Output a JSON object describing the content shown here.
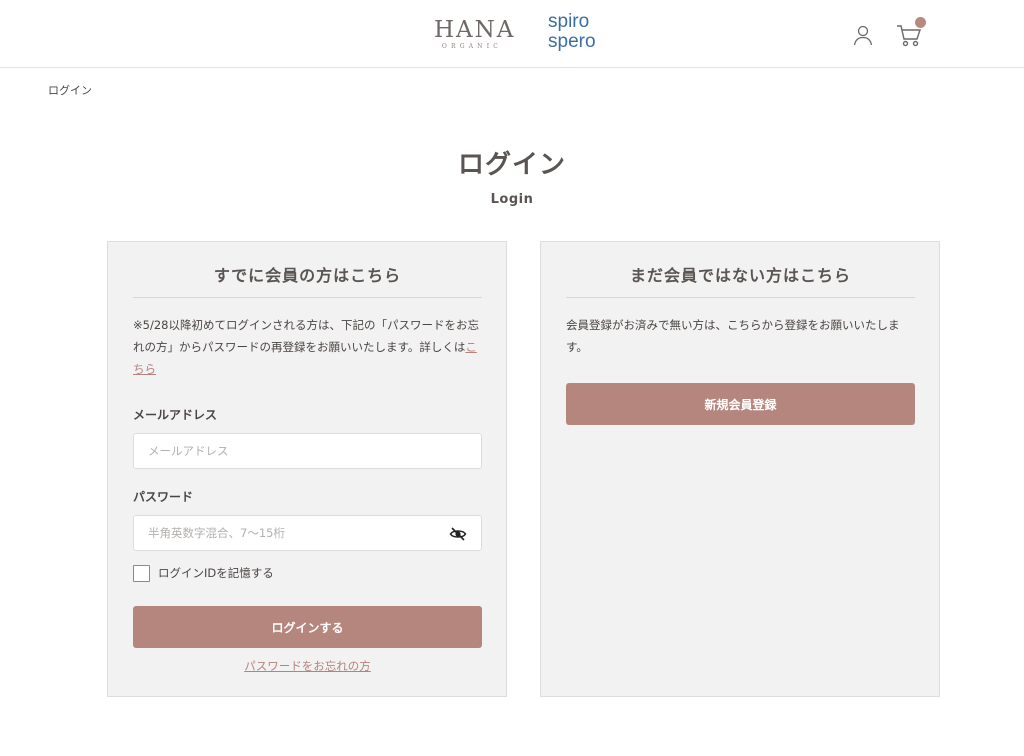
{
  "header": {
    "logo_hana": "HANA",
    "logo_hana_sub": "ORGANIC",
    "logo_spiro_line1": "spiro",
    "logo_spiro_line2": "spero",
    "user_icon": "user-icon",
    "cart_icon": "cart-icon"
  },
  "breadcrumb": "ログイン",
  "page": {
    "title": "ログイン",
    "subtitle": "Login"
  },
  "member_panel": {
    "heading": "すでに会員の方はこちら",
    "notice_text": "※5/28以降初めてログインされる方は、下記の「パスワードをお忘れの方」からパスワードの再登録をお願いいたします。詳しくは",
    "notice_link": "こちら",
    "email_label": "メールアドレス",
    "email_placeholder": "メールアドレス",
    "email_value": "",
    "password_label": "パスワード",
    "password_placeholder": "半角英数字混合、7〜15桁",
    "password_value": "",
    "remember_label": "ログインIDを記憶する",
    "remember_checked": false,
    "login_button": "ログインする",
    "forgot_link": "パスワードをお忘れの方"
  },
  "new_panel": {
    "heading": "まだ会員ではない方はこちら",
    "notice_text": "会員登録がお済みで無い方は、こちらから登録をお願いいたします。",
    "register_button": "新規会員登録"
  },
  "colors": {
    "accent": "#b5867e",
    "panel_bg": "#f3f2f2",
    "text": "#4a4543",
    "spiro_blue": "#3c6fa0"
  }
}
